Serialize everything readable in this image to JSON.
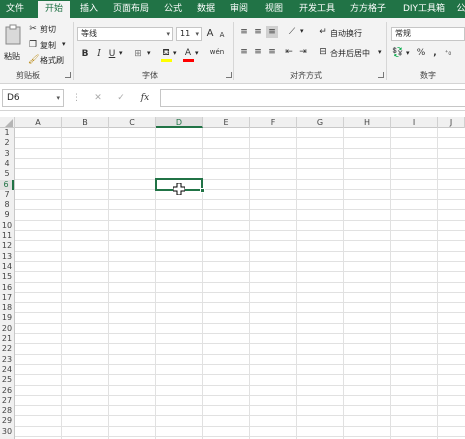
{
  "tabs": [
    "文件",
    "开始",
    "插入",
    "页面布局",
    "公式",
    "数据",
    "审阅",
    "视图",
    "开发工具",
    "方方格子",
    "DIY工具箱",
    "公"
  ],
  "active_tab": "开始",
  "clipboard": {
    "paste_label": "粘贴",
    "cut_label": "剪切",
    "copy_label": "复制",
    "format_painter_label": "格式刷",
    "group_label": "剪贴板"
  },
  "font": {
    "name": "等线",
    "size": "11",
    "group_label": "字体",
    "bold": "B",
    "italic": "I",
    "underline": "U",
    "grow": "A",
    "shrink": "A",
    "font_color": "A",
    "phonetic": "wén"
  },
  "alignment": {
    "wrap_text_label": "自动换行",
    "merge_center_label": "合并后居中",
    "group_label": "对齐方式"
  },
  "number": {
    "format_value": "常规",
    "percent": "%",
    "comma": ",",
    "group_label": "数字"
  },
  "formula_bar": {
    "name_box": "D6",
    "fx": "fx",
    "cancel": "✕",
    "enter": "✓",
    "content": ""
  },
  "columns": [
    "A",
    "B",
    "C",
    "D",
    "E",
    "F",
    "G",
    "H",
    "I",
    "J"
  ],
  "rows": [
    "1",
    "2",
    "3",
    "4",
    "5",
    "6",
    "7",
    "8",
    "9",
    "10",
    "11",
    "12",
    "13",
    "14",
    "15",
    "16",
    "17",
    "18",
    "19",
    "20",
    "21",
    "22",
    "23",
    "24",
    "25",
    "26",
    "27",
    "28",
    "29",
    "30"
  ],
  "selected_cell": {
    "column": "D",
    "row": "6"
  },
  "colors": {
    "brand": "#217346",
    "grid": "#e1e1e1",
    "header_bg": "#f0f0f0"
  }
}
